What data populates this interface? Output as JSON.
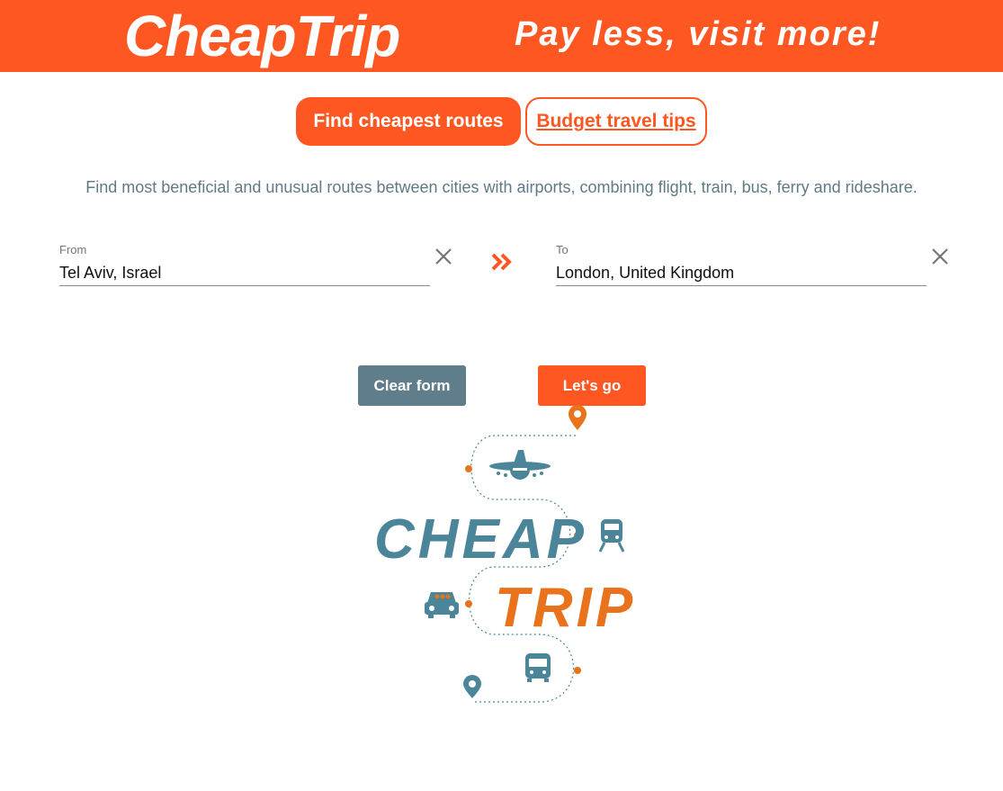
{
  "header": {
    "logo_text": "CheapTrip",
    "slogan": "Pay less, visit more!",
    "background_color": "#ff5722"
  },
  "tabs": [
    {
      "label": "Find cheapest routes",
      "active": true
    },
    {
      "label": "Budget travel tips",
      "active": false
    }
  ],
  "description": "Find most beneficial and unusual routes between cities with airports, combining flight, train, bus, ferry and rideshare.",
  "form": {
    "from": {
      "label": "From",
      "value": "Tel Aviv, Israel",
      "clear_icon": "close-icon"
    },
    "to": {
      "label": "To",
      "value": "London, United Kingdom",
      "clear_icon": "close-icon"
    },
    "direction_icon": "double-chevron-right-icon",
    "clear_button": "Clear form",
    "go_button": "Let's go"
  },
  "illustration": {
    "word1": "CHEAP",
    "word2": "TRIP",
    "icons": [
      "location-pin-icon",
      "airplane-icon",
      "train-icon",
      "car-icon",
      "bus-icon",
      "location-pin-icon"
    ],
    "colors": {
      "teal": "#4a8599",
      "orange": "#e8731c"
    }
  },
  "colors": {
    "accent": "#ff5722",
    "secondary_button": "#607d8b",
    "description_text": "#5f7a85"
  }
}
